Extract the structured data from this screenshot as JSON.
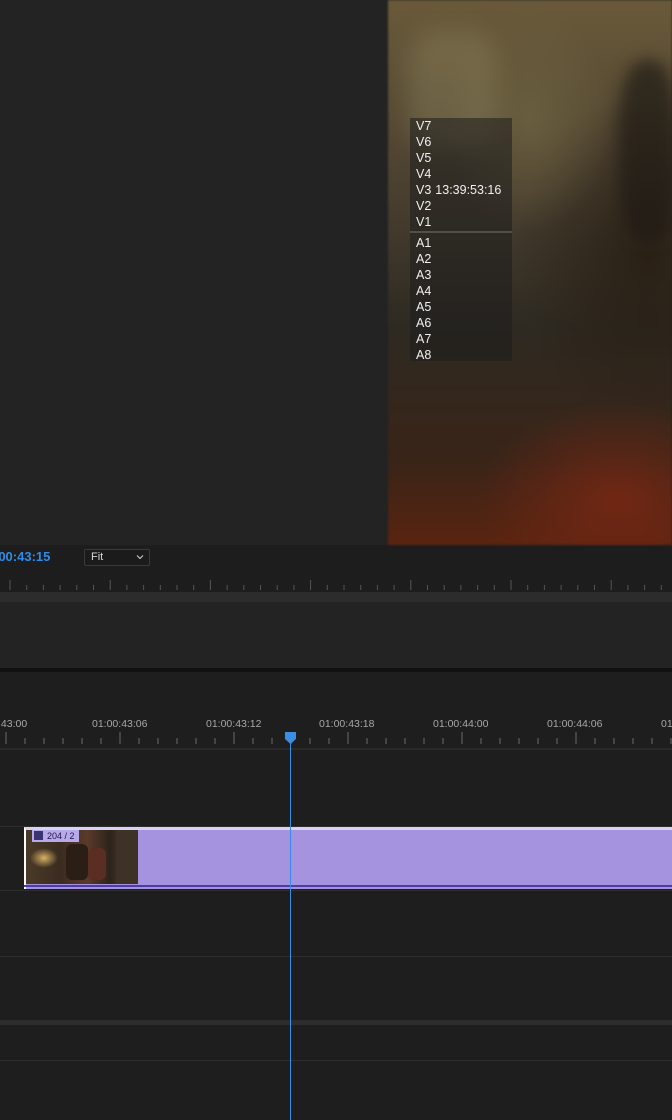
{
  "program_monitor": {
    "track_overlay": {
      "video_tracks": [
        "V7",
        "V6",
        "V5",
        "V4",
        "V3",
        "V2",
        "V1"
      ],
      "timecode_track": "V3",
      "timecode": "13:39:53:16",
      "audio_tracks": [
        "A1",
        "A2",
        "A3",
        "A4",
        "A5",
        "A6",
        "A7",
        "A8"
      ]
    },
    "current_timecode": ":00:43:15",
    "zoom_select": {
      "value": "Fit",
      "icon": "chevron-down-icon"
    },
    "timecode_color": "#2d8ceb"
  },
  "timeline": {
    "ruler_labels": [
      ":43:00",
      "01:00:43:06",
      "01:00:43:12",
      "01:00:43:18",
      "01:00:44:00",
      "01:00:44:06",
      "01"
    ],
    "clip": {
      "label": "204 / 2",
      "icon": "fx-icon",
      "color": "#a593e0"
    },
    "playhead_color": "#3a8ee6"
  }
}
